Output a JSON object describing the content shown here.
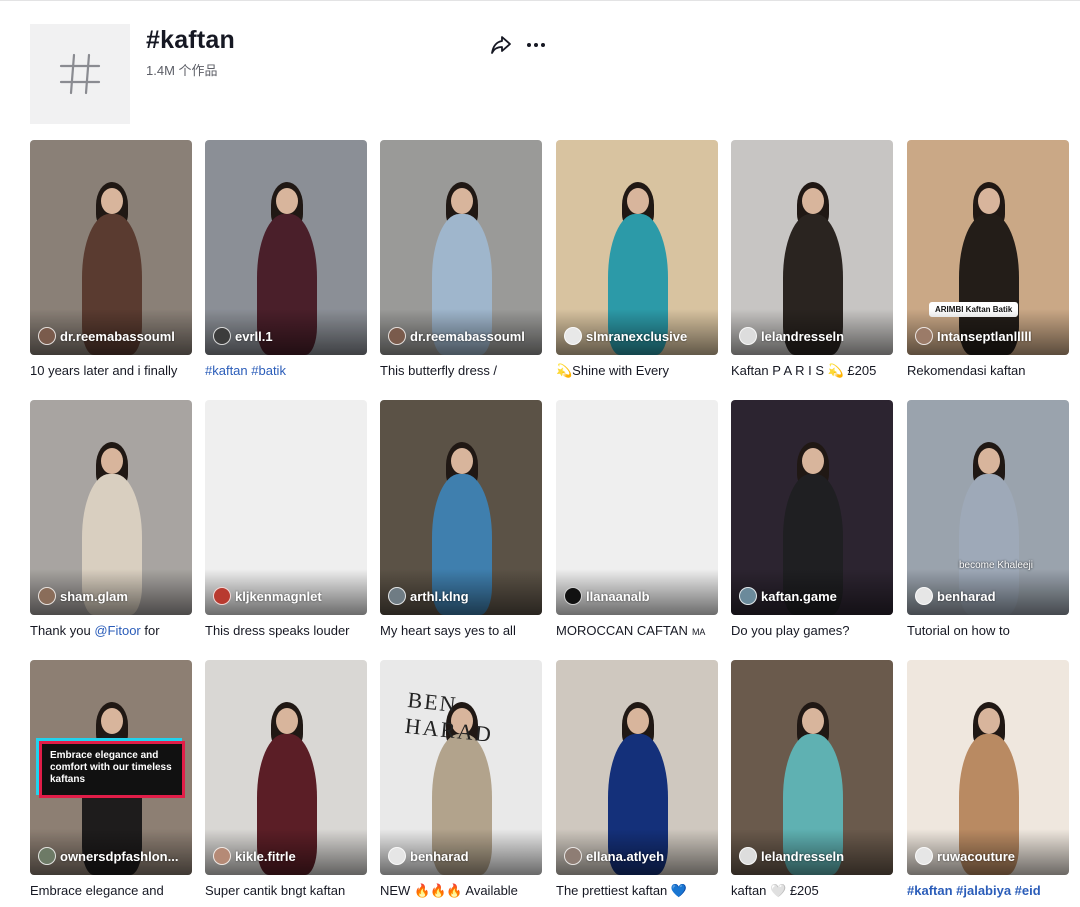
{
  "header": {
    "title": "#kaftan",
    "count": "1.4M 个作品",
    "share_icon": "share-icon",
    "more_icon": "more-icon"
  },
  "videos": [
    {
      "author": "dr.reemabassouml",
      "caption": "10 years later and i finally",
      "bg": "#8a8077",
      "fig": "#5a3b30",
      "avatar": "#7a5b4c"
    },
    {
      "author": "evrll.1",
      "caption_tags": "#kaftan #batik",
      "bg": "#8b8f96",
      "fig": "#4a1f2a",
      "avatar": "#3c3c3c"
    },
    {
      "author": "dr.reemabassouml",
      "caption": "This butterfly dress /",
      "bg": "#9a9a98",
      "fig": "#9fb6cc",
      "avatar": "#7a5b4c"
    },
    {
      "author": "slmranexclusive",
      "caption": "💫Shine with Every",
      "bg": "#d8c3a0",
      "fig": "#2c9aa8",
      "avatar": "#e8e8e8"
    },
    {
      "author": "lelandresseln",
      "caption": "Kaftan P A R I S 💫 £205",
      "bg": "#c7c5c3",
      "fig": "#2a2420",
      "avatar": "#dddddd"
    },
    {
      "author": "Intanseptlanlllll",
      "caption": "Rekomendasi kaftan",
      "bg": "#caa886",
      "fig": "#231d18",
      "avatar": "#9b7b68",
      "tag_label": "ARIMBI Kaftan Batik"
    },
    {
      "author": "sham.glam",
      "caption_prefix": "Thank you ",
      "caption_mention": "@Fitoor",
      "caption_suffix": " for",
      "bg": "#a8a4a1",
      "fig": "#d9cfc0",
      "avatar": "#8a6d5a"
    },
    {
      "author": "kljkenmagnlet",
      "caption": "This dress speaks louder",
      "bg": "#efefef",
      "fig": "",
      "avatar": "#b83a2f"
    },
    {
      "author": "arthl.klng",
      "caption": "My heart says yes to all",
      "bg": "#5b5246",
      "fig": "#3f7fae",
      "avatar": "#6f7c84"
    },
    {
      "author": "llanaanalb",
      "caption": "MOROCCAN CAFTAN",
      "caption_small": "MA",
      "bg": "#efefef",
      "fig": "",
      "avatar": "#111111"
    },
    {
      "author": "kaftan.game",
      "caption": "Do you play games?",
      "bg": "#2c2430",
      "fig": "#1f1f22",
      "avatar": "#6b8a9b"
    },
    {
      "author": "benharad",
      "caption": "Tutorial on how to",
      "bg": "#9aa3ad",
      "fig": "#9ea9b8",
      "avatar": "#e6e6e6",
      "overlay": "become Khaleeji"
    },
    {
      "author": "ownersdpfashlon...",
      "caption": "Embrace elegance and",
      "bg": "#8d7f73",
      "fig": "#1e1c1c",
      "avatar": "#6d7a66",
      "overlay_box": "Embrace elegance and comfort with our timeless kaftans"
    },
    {
      "author": "kikle.fitrle",
      "caption": "Super cantik bngt kaftan",
      "bg": "#d9d7d4",
      "fig": "#5b1e26",
      "avatar": "#b58a76"
    },
    {
      "author": "benharad",
      "caption": "NEW 🔥🔥🔥 Available",
      "bg": "#e9e9e9",
      "fig": "#b2a38c",
      "avatar": "#e6e6e6",
      "brand": "BEN HARAD"
    },
    {
      "author": "ellana.atlyeh",
      "caption": "The prettiest kaftan 💙",
      "bg": "#cfc8bf",
      "fig": "#14307a",
      "avatar": "#8e7d74"
    },
    {
      "author": "lelandresseln",
      "caption": "kaftan 🤍 £205",
      "bg": "#6a5a4c",
      "fig": "#5fb1b2",
      "avatar": "#dddddd"
    },
    {
      "author": "ruwacouture",
      "caption_tags": "#kaftan #jalabiya #eid",
      "bg": "#efe7de",
      "fig": "#b98a62",
      "avatar": "#e6e6e6"
    }
  ]
}
